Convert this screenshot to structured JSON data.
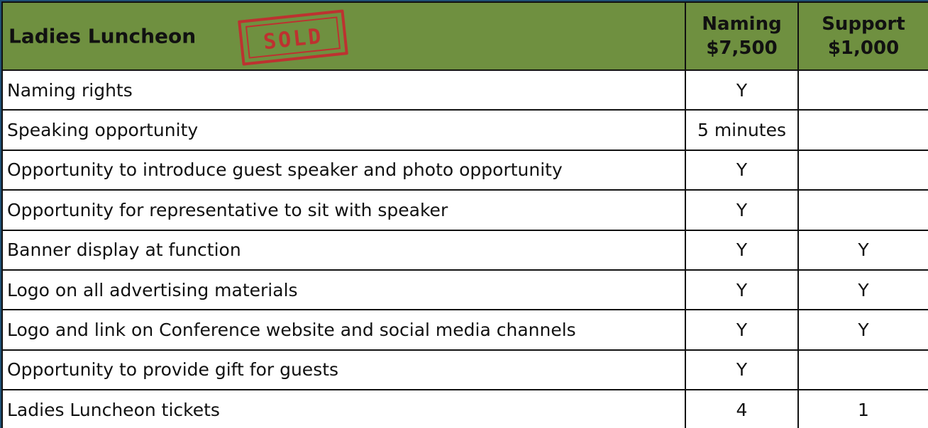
{
  "table": {
    "title": "Ladies Luncheon",
    "stamp_text": "SOLD",
    "columns": [
      {
        "line1": "Naming",
        "line2": "$7,500"
      },
      {
        "line1": "Support",
        "line2": "$1,000"
      }
    ],
    "rows": [
      {
        "feature": "Naming rights",
        "naming": "Y",
        "support": ""
      },
      {
        "feature": "Speaking opportunity",
        "naming": "5 minutes",
        "support": ""
      },
      {
        "feature": "Opportunity to introduce guest speaker and photo opportunity",
        "naming": "Y",
        "support": ""
      },
      {
        "feature": "Opportunity for representative to sit with speaker",
        "naming": "Y",
        "support": ""
      },
      {
        "feature": "Banner display at function",
        "naming": "Y",
        "support": "Y"
      },
      {
        "feature": "Logo on all advertising materials",
        "naming": "Y",
        "support": "Y"
      },
      {
        "feature": "Logo and link on Conference website and social media channels",
        "naming": "Y",
        "support": "Y"
      },
      {
        "feature": "Opportunity to provide gift for guests",
        "naming": "Y",
        "support": ""
      },
      {
        "feature": "Ladies Luncheon tickets",
        "naming": "4",
        "support": "1"
      }
    ]
  },
  "colors": {
    "header_bg": "#6f9040",
    "frame": "#1d4e73",
    "stamp": "#c8262e",
    "border": "#111111"
  }
}
